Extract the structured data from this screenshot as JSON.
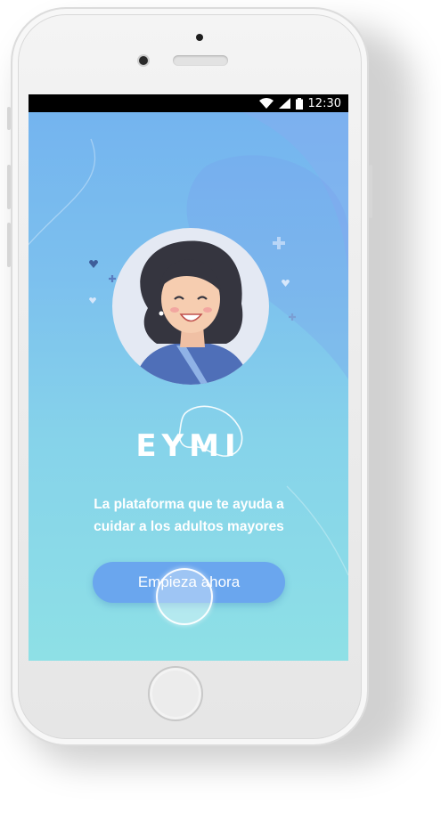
{
  "status_bar": {
    "time": "12:30",
    "icons": [
      "wifi-icon",
      "cellular-signal-icon",
      "battery-icon"
    ]
  },
  "onboarding": {
    "brand_name": "EYMI",
    "tagline": "La plataforma que te ayuda a\ncuidar a los adultos mayores",
    "cta_label": "Empieza ahora"
  },
  "colors": {
    "gradient_top": "#74b4ef",
    "gradient_bottom": "#8ee0e6",
    "button": "#6aa6ee",
    "text": "#ffffff"
  }
}
